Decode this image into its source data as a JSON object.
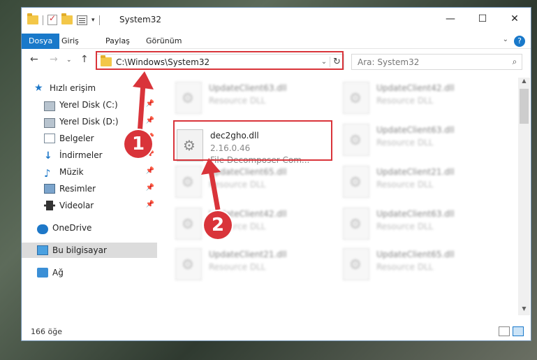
{
  "window": {
    "title": "System32",
    "buttons": {
      "minimize": "—",
      "maximize": "☐",
      "close": "✕"
    }
  },
  "ribbon": {
    "tabs": [
      {
        "label": "Dosya",
        "active": true
      },
      {
        "label": "Giriş",
        "active": false
      },
      {
        "label": "Paylaş",
        "active": false
      },
      {
        "label": "Görünüm",
        "active": false
      }
    ],
    "help": "?"
  },
  "address": {
    "path": "C:\\Windows\\System32",
    "refresh": "↻",
    "dropdown": "⌄"
  },
  "search": {
    "placeholder": "Ara: System32",
    "icon": "search-icon"
  },
  "sidebar": {
    "items": [
      {
        "label": "Hızlı erişim",
        "icon": "star-icon"
      },
      {
        "label": "Yerel Disk (C:)",
        "icon": "disk-icon",
        "pinned": true
      },
      {
        "label": "Yerel Disk (D:)",
        "icon": "disk-icon",
        "pinned": true
      },
      {
        "label": "Belgeler",
        "icon": "documents-icon",
        "pinned": true
      },
      {
        "label": "İndirmeler",
        "icon": "download-icon",
        "pinned": true
      },
      {
        "label": "Müzik",
        "icon": "music-icon",
        "pinned": true
      },
      {
        "label": "Resimler",
        "icon": "pictures-icon",
        "pinned": true
      },
      {
        "label": "Videolar",
        "icon": "videos-icon",
        "pinned": true
      },
      {
        "label": "OneDrive",
        "icon": "cloud-icon"
      },
      {
        "label": "Bu bilgisayar",
        "icon": "computer-icon",
        "selected": true
      },
      {
        "label": "Ağ",
        "icon": "network-icon"
      }
    ]
  },
  "files": {
    "focus": {
      "name": "dec2gho.dll",
      "version": "2.16.0.46",
      "description": "File Decomposer Com..."
    },
    "blurred": [
      {
        "name": "UpdateClient63.dll",
        "desc": "Resource DLL"
      },
      {
        "name": "UpdateClient42.dll",
        "desc": "Resource DLL"
      },
      {
        "name": "UpdateClient63.dll",
        "desc": "Resource DLL"
      },
      {
        "name": "UpdateClient65.dll",
        "desc": "Resource DLL"
      },
      {
        "name": "UpdateClient21.dll",
        "desc": "Resource DLL"
      },
      {
        "name": "UpdateClient42.dll",
        "desc": "Resource DLL"
      },
      {
        "name": "UpdateClient63.dll",
        "desc": "Resource DLL"
      },
      {
        "name": "UpdateClient21.dll",
        "desc": "Resource DLL"
      },
      {
        "name": "UpdateClient65.dll",
        "desc": "Resource DLL"
      }
    ]
  },
  "status": {
    "count": "166 öğe"
  },
  "annotations": {
    "step1": "1",
    "step2": "2",
    "color": "#d9343a"
  }
}
